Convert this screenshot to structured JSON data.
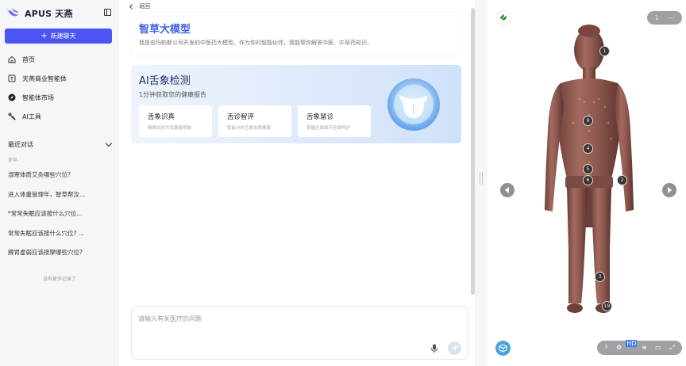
{
  "brand": {
    "name": "APUS 天燕"
  },
  "sidebar": {
    "new_chat_label": "新建聊天",
    "nav": [
      {
        "label": "首页",
        "icon": "home-icon"
      },
      {
        "label": "天燕商业智能体",
        "icon": "agent-box-icon"
      },
      {
        "label": "智能体市场",
        "icon": "compass-icon"
      },
      {
        "label": "AI工具",
        "icon": "tool-icon"
      }
    ],
    "recent_title": "最近对话",
    "recent_group": "更早",
    "recent_items": [
      "湿寒体质艾灸哪些穴位?",
      "进入体重管理年，智草帮汝...",
      "*常常失眠应该按什么穴位...",
      "常常失眠应该按什么穴位? ...",
      "脾胃虚弱应该按摩哪些穴位?"
    ],
    "no_more": "没有更多记录了"
  },
  "main": {
    "back_label": "返回",
    "intro": {
      "title": "智草大模型",
      "desc": "我是由玛帕斯公司开发的中医药大模型。作为你的智能伙伴，我能帮你解答中医、中草药知识。"
    },
    "tongue": {
      "title": "AI舌象检测",
      "subtitle": "1分钟获取您的健康报告",
      "features": [
        {
          "title": "舌象识真",
          "desc": "精确识别为您健康把脉"
        },
        {
          "title": "舌诊智评",
          "desc": "智能分析舌象体质健康"
        },
        {
          "title": "舌象慧诊",
          "desc": "掌握全面细节全面呵护"
        }
      ]
    },
    "input_placeholder": "请输入有关医疗的问题"
  },
  "viewer": {
    "points": [
      "1",
      "9",
      "4",
      "5",
      "6",
      "2",
      "3",
      "19"
    ],
    "hd_badge": "HD",
    "colors": {
      "skin": "#8a534a",
      "point": "#3b3232",
      "accent": "#4c55f2"
    }
  }
}
